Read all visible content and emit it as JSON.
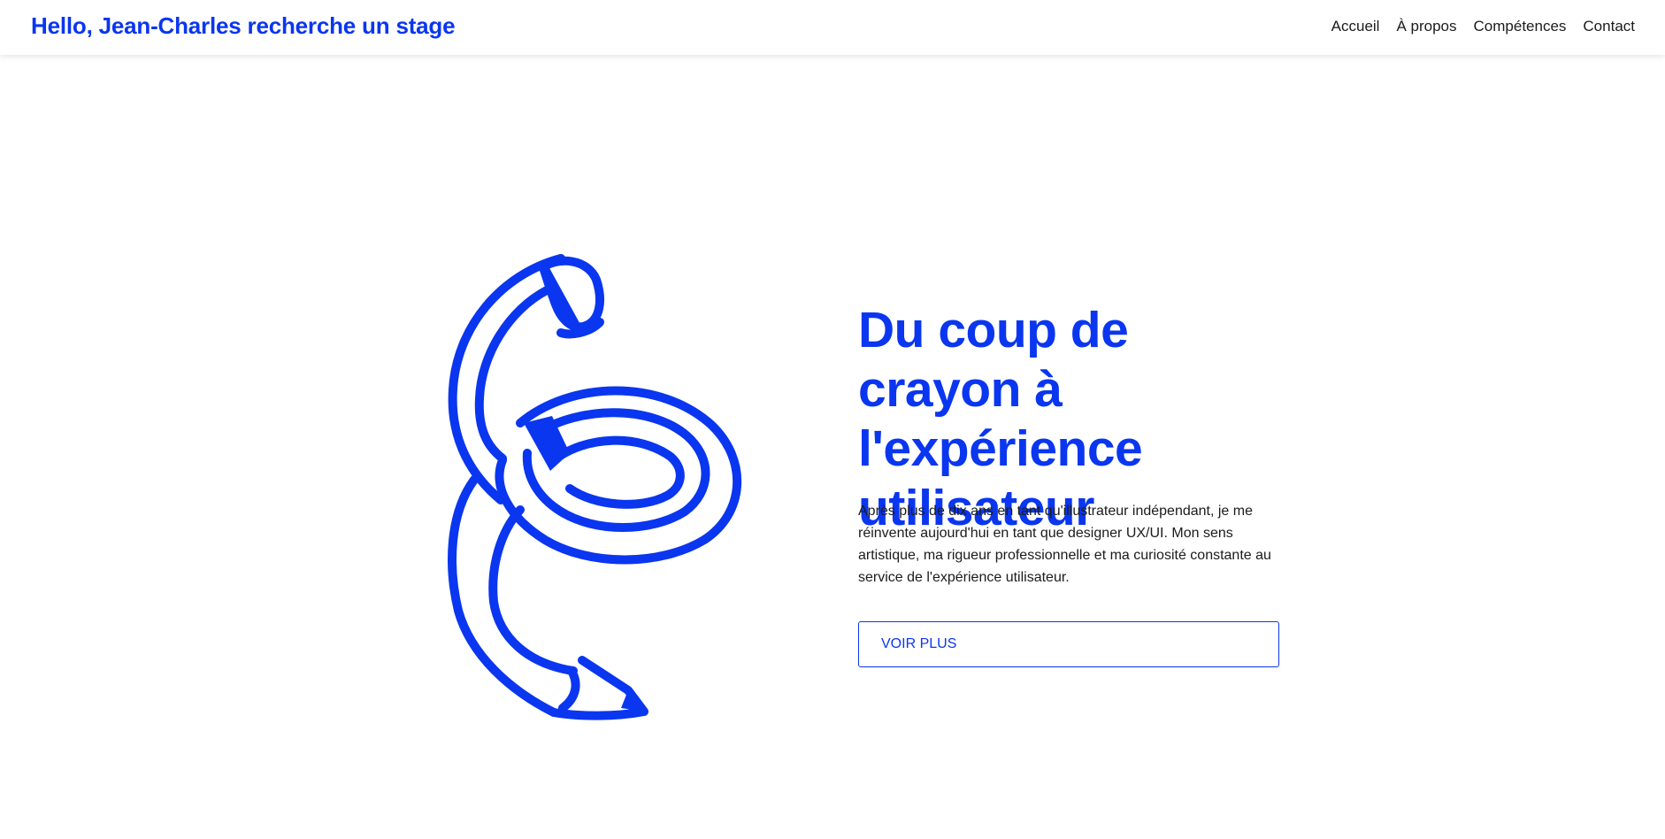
{
  "header": {
    "brand": "Hello, Jean-Charles recherche un stage",
    "nav": [
      "Accueil",
      "À propos",
      "Compétences",
      "Contact"
    ]
  },
  "hero": {
    "title": "Du coup de crayon à l'expérience utilisateur",
    "description": "Après plus de dix ans en tant qu'illustrateur indépendant, je me réinvente aujourd'hui en tant que designer UX/UI. Mon sens artistique, ma rigueur professionnelle et ma curiosité constante au service de l'expérience utilisateur.",
    "cta_label": "VOIR PLUS",
    "illustration": "pencil-spiral-illustration"
  },
  "colors": {
    "accent": "#0a36f0",
    "text": "#1b1b1b",
    "background": "#ffffff"
  }
}
